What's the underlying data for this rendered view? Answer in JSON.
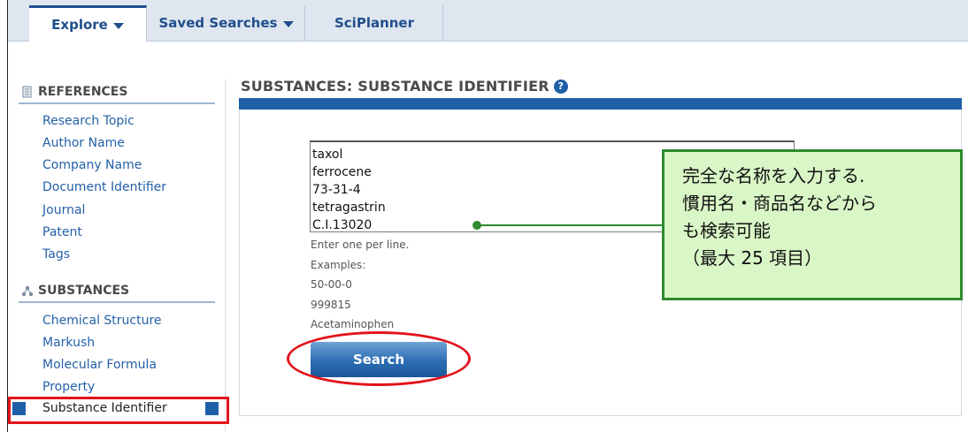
{
  "tabs": [
    {
      "label": "Explore",
      "dropdown": true,
      "active": true
    },
    {
      "label": "Saved Searches",
      "dropdown": true,
      "active": false
    },
    {
      "label": "SciPlanner",
      "dropdown": false,
      "active": false
    }
  ],
  "sidebar": {
    "references": {
      "heading": "REFERENCES",
      "icon": "document-icon",
      "items": [
        "Research Topic",
        "Author Name",
        "Company Name",
        "Document Identifier",
        "Journal",
        "Patent",
        "Tags"
      ]
    },
    "substances": {
      "heading": "SUBSTANCES",
      "icon": "molecule-icon",
      "items": [
        "Chemical Structure",
        "Markush",
        "Molecular Formula",
        "Property",
        "Substance Identifier"
      ],
      "selected": "Substance Identifier"
    }
  },
  "main": {
    "title": "SUBSTANCES: SUBSTANCE IDENTIFIER",
    "help_icon": "?",
    "input_lines": [
      "taxol",
      "ferrocene",
      "73-31-4",
      "tetragastrin",
      "C.I.13020"
    ],
    "hint": "Enter one per line.",
    "examples_label": "Examples:",
    "examples": [
      "50-00-0",
      "999815",
      "Acetaminophen"
    ],
    "search_label": "Search"
  },
  "callout": {
    "lines": [
      "完全な名称を入力する.",
      "慣用名・商品名などから",
      "も検索可能",
      "（最大 25 項目）"
    ]
  },
  "colors": {
    "accent": "#1f5fa8",
    "highlight": "#e3131b",
    "callout_border": "#2e8b2e",
    "callout_bg": "#d9f6c6"
  }
}
